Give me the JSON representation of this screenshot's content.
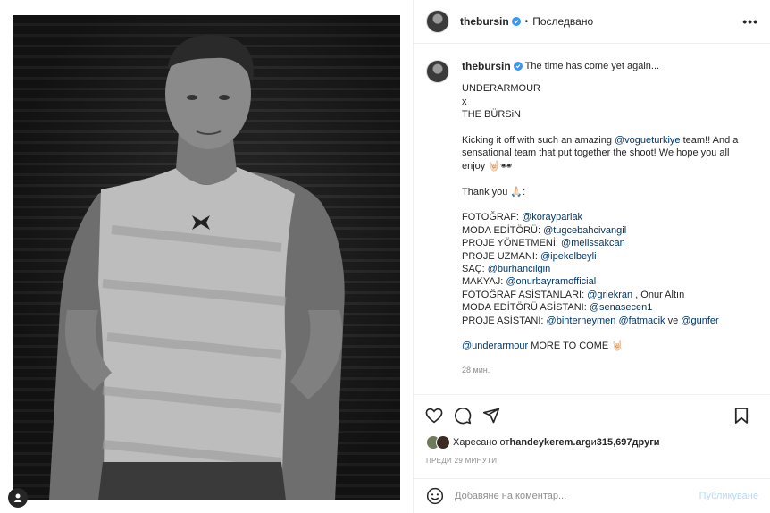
{
  "post": {
    "username": "thebursin",
    "follow_state": "Последвано",
    "more_glyph": "•••",
    "caption_title": "The time has come yet again...",
    "caption_lines": [
      [
        {
          "t": "UNDERARMOUR"
        }
      ],
      [
        {
          "t": "x"
        }
      ],
      [
        {
          "t": "THE BÜRSiN"
        }
      ],
      [
        {
          "t": ""
        }
      ],
      [
        {
          "t": "Kicking it off with such an amazing "
        },
        {
          "t": "@vogueturkiye",
          "m": true
        },
        {
          "t": " team!! And a"
        }
      ],
      [
        {
          "t": "sensational team that put together the shoot! We hope you all"
        }
      ],
      [
        {
          "t": "enjoy 🤘🏻🕶"
        }
      ],
      [
        {
          "t": ""
        }
      ],
      [
        {
          "t": "Thank you 🙏🏻:"
        }
      ],
      [
        {
          "t": ""
        }
      ],
      [
        {
          "t": "FOTOĞRAF: "
        },
        {
          "t": "@koraypariak",
          "m": true
        }
      ],
      [
        {
          "t": "MODA EDİTÖRÜ: "
        },
        {
          "t": "@tugcebahcivangil",
          "m": true
        }
      ],
      [
        {
          "t": "PROJE YÖNETMENİ: "
        },
        {
          "t": "@melissakcan",
          "m": true
        }
      ],
      [
        {
          "t": "PROJE UZMANI: "
        },
        {
          "t": "@ipekelbeyli",
          "m": true
        }
      ],
      [
        {
          "t": "SAÇ: "
        },
        {
          "t": "@burhancilgin",
          "m": true
        }
      ],
      [
        {
          "t": "MAKYAJ: "
        },
        {
          "t": "@onurbayramofficial",
          "m": true
        }
      ],
      [
        {
          "t": "FOTOĞRAF ASİSTANLARI: "
        },
        {
          "t": "@griekran",
          "m": true
        },
        {
          "t": " , Onur Altın"
        }
      ],
      [
        {
          "t": "MODA EDİTÖRÜ ASİSTANI: "
        },
        {
          "t": "@senasecen1",
          "m": true
        }
      ],
      [
        {
          "t": "PROJE ASİSTANI: "
        },
        {
          "t": "@bihterneymen",
          "m": true
        },
        {
          "t": " "
        },
        {
          "t": "@fatmacik",
          "m": true
        },
        {
          "t": " ve "
        },
        {
          "t": "@gunfer",
          "m": true
        }
      ],
      [
        {
          "t": ""
        }
      ],
      [
        {
          "t": "@underarmour",
          "m": true
        },
        {
          "t": " MORE TO COME 🤘🏻"
        }
      ]
    ],
    "caption_time": "28 мин.",
    "likes_prefix": "Харесано от ",
    "likes_user": "handeykerem.arg",
    "likes_middle": " и ",
    "likes_count": "315,697",
    "likes_suffix": " други",
    "posted_ago": "ПРЕДИ 29 МИНУТИ",
    "comment_placeholder": "Добавяне на коментар...",
    "publish_label": "Публикуване"
  },
  "icons": {
    "like": "heart-icon",
    "comment": "comment-icon",
    "share": "send-icon",
    "save": "bookmark-icon",
    "emoji": "emoji-icon",
    "tag": "user-tag-icon"
  },
  "colors": {
    "verified": "#3897f0",
    "mention": "#00376b",
    "publish_disabled": "#b3dbff",
    "muted": "#8e8e8e"
  }
}
